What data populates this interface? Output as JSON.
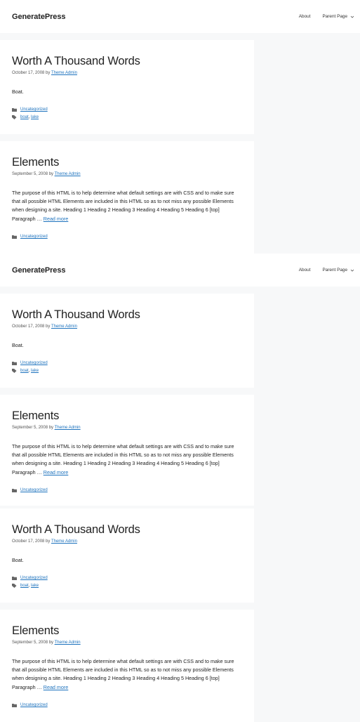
{
  "brand": "GeneratePress",
  "nav": {
    "about": "About",
    "parent": "Parent Page"
  },
  "posts": {
    "p1": {
      "title": "Worth A Thousand Words",
      "date": "October 17, 2008",
      "by": "by",
      "author": "Theme Admin",
      "excerpt": "Boat.",
      "category": "Uncategorized",
      "tag1": "boat",
      "tag2": "lake"
    },
    "p2": {
      "title": "Elements",
      "date": "September 5, 2008",
      "by": "by",
      "author": "Theme Admin",
      "excerpt": "The purpose of this HTML is to help determine what default settings are with CSS and to make sure that all possible HTML Elements are included in this HTML so as to not miss any possible Elements when designing a site. Heading 1 Heading 2 Heading 3 Heading 4 Heading 5 Heading 6 [top] Paragraph …",
      "read_more": "Read more",
      "category": "Uncategorized"
    }
  }
}
